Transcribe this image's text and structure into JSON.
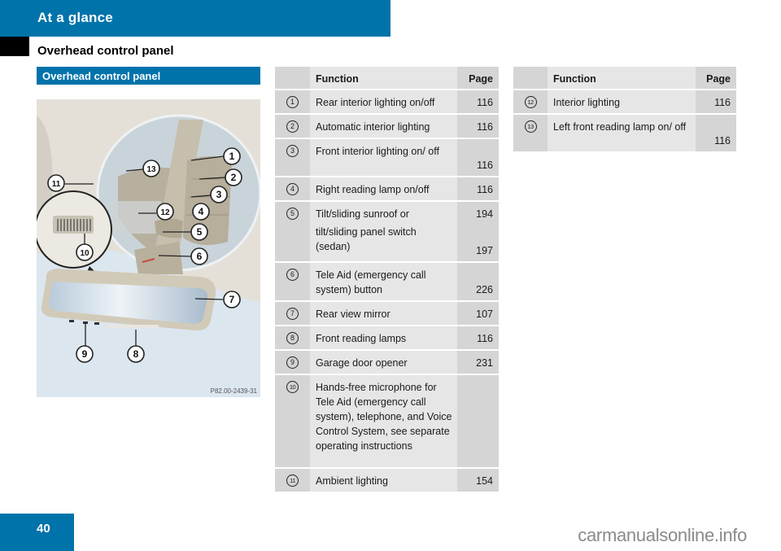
{
  "header": {
    "title": "At a glance"
  },
  "section": {
    "title": "Overhead control panel"
  },
  "panel": {
    "bar_label": "Overhead control panel",
    "figure_code": "P82.00-2439-31",
    "callouts": [
      "1",
      "2",
      "3",
      "4",
      "5",
      "6",
      "7",
      "8",
      "9",
      "10",
      "11",
      "12",
      "13"
    ]
  },
  "table_headers": {
    "function": "Function",
    "page": "Page"
  },
  "table_left": [
    {
      "num": "1",
      "function": "Rear interior lighting on/off",
      "page": "116"
    },
    {
      "num": "2",
      "function": "Automatic interior lighting",
      "page": "116"
    },
    {
      "num": "3",
      "function": "Front interior lighting on/ off",
      "page": "116"
    },
    {
      "num": "4",
      "function": "Right reading lamp on/off",
      "page": "116"
    },
    {
      "num": "5",
      "function": "Tilt/sliding sunroof or",
      "page": "194",
      "function2": "tilt/sliding panel switch (sedan)",
      "page2": "197"
    },
    {
      "num": "6",
      "function": "Tele Aid (emergency call system) button",
      "page": "226"
    },
    {
      "num": "7",
      "function": "Rear view mirror",
      "page": "107"
    },
    {
      "num": "8",
      "function": "Front reading lamps",
      "page": "116"
    },
    {
      "num": "9",
      "function": "Garage door opener",
      "page": "231"
    },
    {
      "num": "10",
      "function": "Hands-free microphone for Tele Aid (emergency call system), telephone, and Voice Control System, see separate operating instructions",
      "page": ""
    },
    {
      "num": "11",
      "function": "Ambient lighting",
      "page": "154"
    }
  ],
  "table_right": [
    {
      "num": "12",
      "function": "Interior lighting",
      "page": "116"
    },
    {
      "num": "13",
      "function": "Left front reading lamp on/ off",
      "page": "116"
    }
  ],
  "footer": {
    "page_number": "40",
    "watermark": "carmanualsonline.info"
  },
  "colors": {
    "brand_blue": "#0073ab",
    "cell_dark": "#d5d5d5",
    "cell_light": "#e6e6e6"
  }
}
